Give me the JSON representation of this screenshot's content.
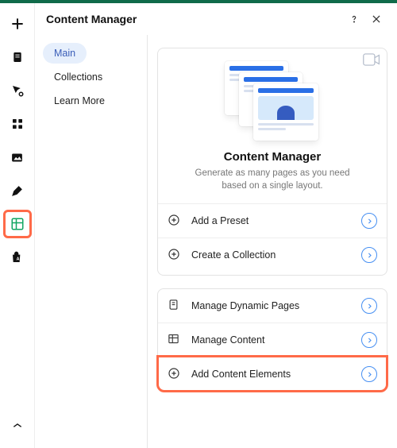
{
  "panel": {
    "title": "Content Manager",
    "nav": {
      "items": [
        {
          "label": "Main",
          "active": true
        },
        {
          "label": "Collections",
          "active": false
        },
        {
          "label": "Learn More",
          "active": false
        }
      ]
    },
    "hero": {
      "title": "Content Manager",
      "subtitle": "Generate as many pages as you need based on a single layout."
    },
    "actions1": [
      {
        "label": "Add a Preset"
      },
      {
        "label": "Create a Collection"
      }
    ],
    "actions2": [
      {
        "label": "Manage Dynamic Pages"
      },
      {
        "label": "Manage Content"
      },
      {
        "label": "Add Content Elements",
        "highlight": true
      }
    ]
  },
  "colors": {
    "accent": "#468ff2",
    "highlight": "#ff6a48",
    "active_icon": "#11a561"
  }
}
